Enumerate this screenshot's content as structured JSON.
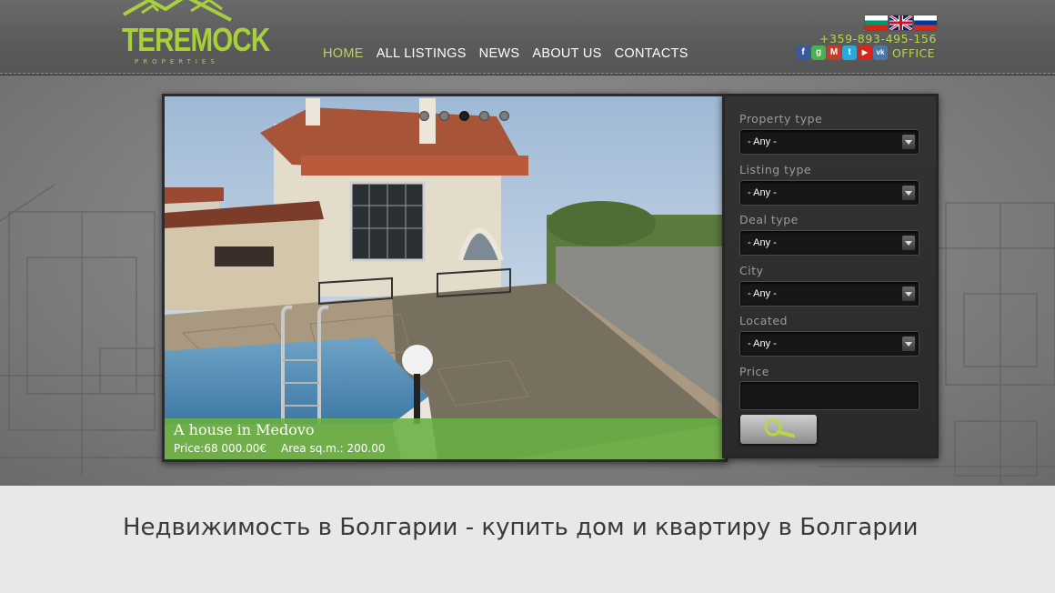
{
  "logo": {
    "name": "TEREMOCK",
    "subtitle": "PROPERTIES"
  },
  "nav": [
    {
      "label": "HOME",
      "active": true
    },
    {
      "label": "ALL LISTINGS",
      "active": false
    },
    {
      "label": "NEWS",
      "active": false
    },
    {
      "label": "ABOUT US",
      "active": false
    },
    {
      "label": "CONTACTS",
      "active": false
    }
  ],
  "languages": [
    "bg-flag-icon",
    "uk-flag-icon",
    "ru-flag-icon"
  ],
  "contact": {
    "phone": "+359-893-495-156",
    "office_label": "OFFICE"
  },
  "socials": [
    {
      "icon": "facebook-icon",
      "glyph": "f",
      "color": "#3b5998"
    },
    {
      "icon": "google-icon",
      "glyph": "g",
      "color": "#4caf50"
    },
    {
      "icon": "gmail-icon",
      "glyph": "M",
      "color": "#c43b2c"
    },
    {
      "icon": "twitter-icon",
      "glyph": "t",
      "color": "#2aa9e0"
    },
    {
      "icon": "youtube-icon",
      "glyph": "▶",
      "color": "#d9261c"
    },
    {
      "icon": "vk-icon",
      "glyph": "vk",
      "color": "#4a76a8"
    }
  ],
  "slider": {
    "title": "A house in Medovo",
    "price": "Price:68 000.00€",
    "area": "Area sq.m.: 200.00",
    "dots": 5,
    "current_dot": 2
  },
  "search": {
    "fields": [
      {
        "label": "Property type",
        "value": "- Any -"
      },
      {
        "label": "Listing type",
        "value": "- Any -"
      },
      {
        "label": "Deal type",
        "value": "- Any -"
      },
      {
        "label": "City",
        "value": "- Any -"
      },
      {
        "label": "Located",
        "value": "- Any -"
      }
    ],
    "price_label": "Price",
    "price_value": "",
    "button_icon": "magnifier-icon"
  },
  "content": {
    "title": "Недвижимость в Болгарии - купить дом и квартиру в Болгарии"
  },
  "colors": {
    "accent": "#b5d84a",
    "caption": "#68b042"
  }
}
